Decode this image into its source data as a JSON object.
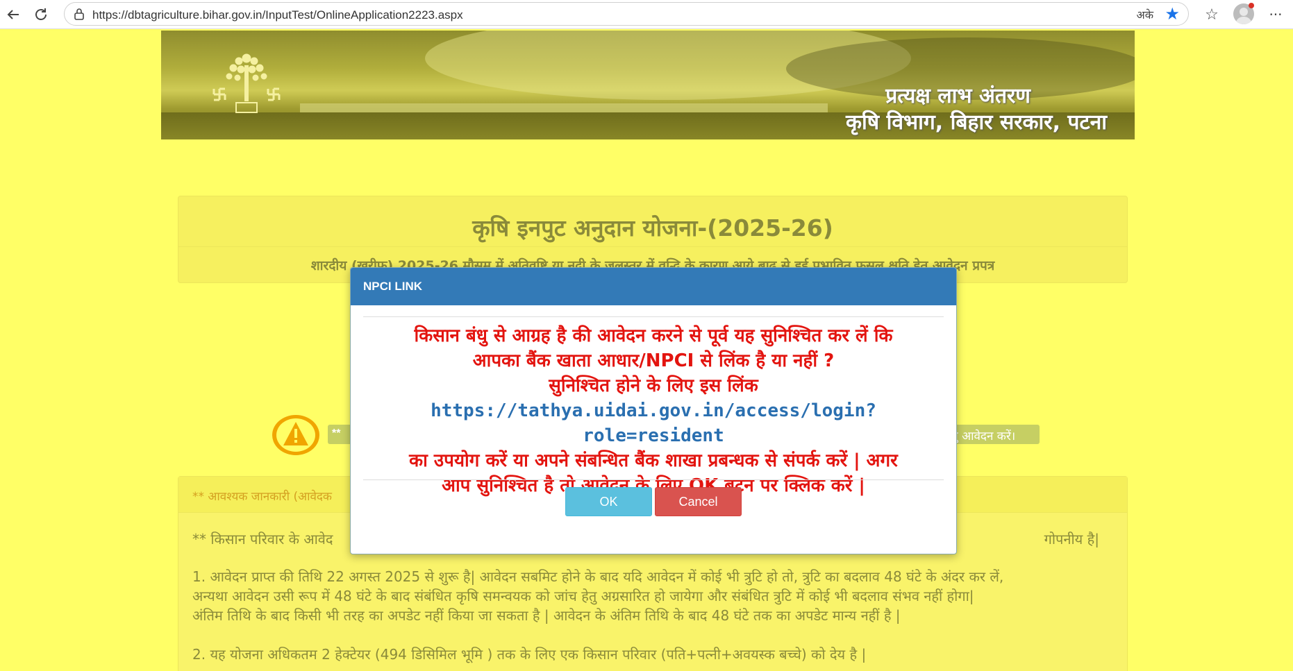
{
  "browser": {
    "url": "https://dbtagriculture.bihar.gov.in/InputTest/OnlineApplication2223.aspx",
    "read_aloud": "अके",
    "icons": [
      "back-icon",
      "refresh-icon",
      "lock-icon",
      "star-icon",
      "favorites-icon",
      "profile-icon",
      "more-icon"
    ]
  },
  "banner": {
    "line1": "प्रत्यक्ष लाभ अंतरण",
    "line2": "कृषि विभाग, बिहार सरकार, पटना"
  },
  "header": {
    "title": "कृषि इनपुट अनुदान योजना-(2025-26)",
    "subtitle": "शारदीय (खरीफ) 2025-26 मौसम में अतिवृष्टि या नदी के जलस्तर में वृद्धि के कारण आये बाढ़ से हुई प्रभावित फसल क्षति हेतु आवेदन प्रपत्र"
  },
  "notice": {
    "left_text": "** ",
    "right_text": "तु आवेदन करें।"
  },
  "info": {
    "heading": "** आवश्यक जानकारी (आवेदक",
    "line0_left": "** किसान परिवार के आवेद",
    "line0_right": "गोपनीय है|",
    "line1": "1. आवेदन प्राप्त की तिथि 22 अगस्त 2025 से शुरू है| आवेदन सबमिट होने के बाद यदि आवेदन में कोई भी त्रुटि हो तो, त्रुटि का बदलाव 48 घंटे के अंदर कर लें,",
    "line2": "अन्यथा आवेदन उसी रूप में 48 घंटे के बाद संबंधित कृषि समन्वयक को जांच हेतु अग्रसारित हो जायेगा और संबंधित त्रुटि में कोई भी बदलाव संभव नहीं होगा|",
    "line3": "अंतिम तिथि के बाद किसी भी तरह का अपडेट नहीं किया जा सकता है | आवेदन के अंतिम तिथि के बाद 48 घंटे तक का अपडेट मान्य नहीं है |",
    "line4": "2. यह योजना अधिकतम 2 हेक्टेयर (494 डिसिमिल भूमि ) तक के लिए एक किसान परिवार (पति+पत्नी+अवयस्क बच्चे) को देय है |"
  },
  "modal": {
    "title": "NPCI LINK",
    "line1": "किसान बंधु से आग्रह है की आवेदन करने से पूर्व यह सुनिश्चित कर लें कि",
    "line2": "आपका बैंक खाता आधार/NPCI से लिंक है या नहीं ?",
    "line3": "सुनिश्चित होने के लिए इस लिंक",
    "link": "https://tathya.uidai.gov.in/access/login?role=resident",
    "line4": "का उपयोग करें या अपने संबन्धित बैंक शाखा प्रबन्धक से संपर्क करें | अगर",
    "line5": "आप सुनिश्चित है तो आवेदन के लिए OK बटन पर क्लिक करें |",
    "ok_label": "OK",
    "cancel_label": "Cancel"
  },
  "colors": {
    "page_bg": "#ffff66",
    "modal_header": "#337ab7",
    "modal_text": "#e3140f",
    "link": "#2a6fb0",
    "ok": "#5bc0de",
    "cancel": "#d9534f"
  }
}
